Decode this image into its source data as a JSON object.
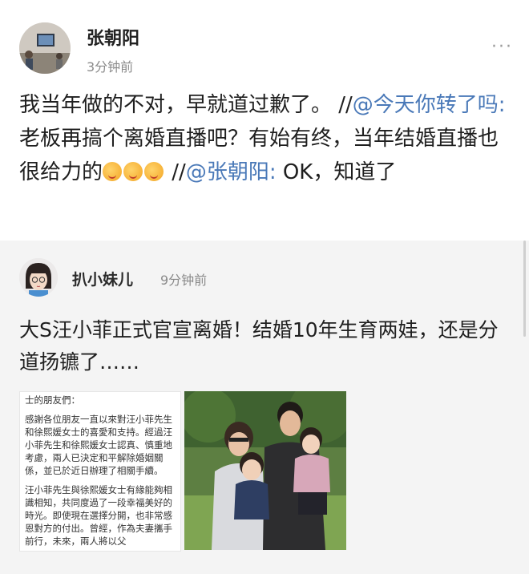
{
  "post": {
    "author": "张朝阳",
    "time": "3分钟前",
    "more_label": "···",
    "text_part1": "我当年做的不对，早就道过歉了。 //",
    "mention1": "@今天你转了吗:",
    "text_part2": " 老板再搞个离婚直播吧？有始有终，当年结婚直播也很给力的",
    "text_part3": " //",
    "mention2": "@张朝阳:",
    "text_part4": " OK，知道了"
  },
  "retweet": {
    "author": "扒小妹儿",
    "time": "9分钟前",
    "text": "大S汪小菲正式官宣离婚！结婚10年生育两娃，还是分道扬镳了……",
    "letter": {
      "line0": "士的朋友們：",
      "para1": "感謝各位朋友一直以來對汪小菲先生和徐熙媛女士的喜愛和支持。經過汪小菲先生和徐熙媛女士認真、慎重地考慮，兩人已決定和平解除婚姻關係，並已於近日辦理了相關手續。",
      "para2": "汪小菲先生與徐熙媛女士有緣能夠相識相知，共同度過了一段幸福美好的時光。即使現在選擇分開，也非常感恩對方的付出。曾經，作為夫妻攜手前行，未來，兩人將以父"
    }
  },
  "colors": {
    "mention": "#4a79b8",
    "retweet_bg": "#f4f4f4",
    "meta": "#8a8a8a"
  },
  "icons": {
    "emoji": "laughing-tears-emoji"
  }
}
